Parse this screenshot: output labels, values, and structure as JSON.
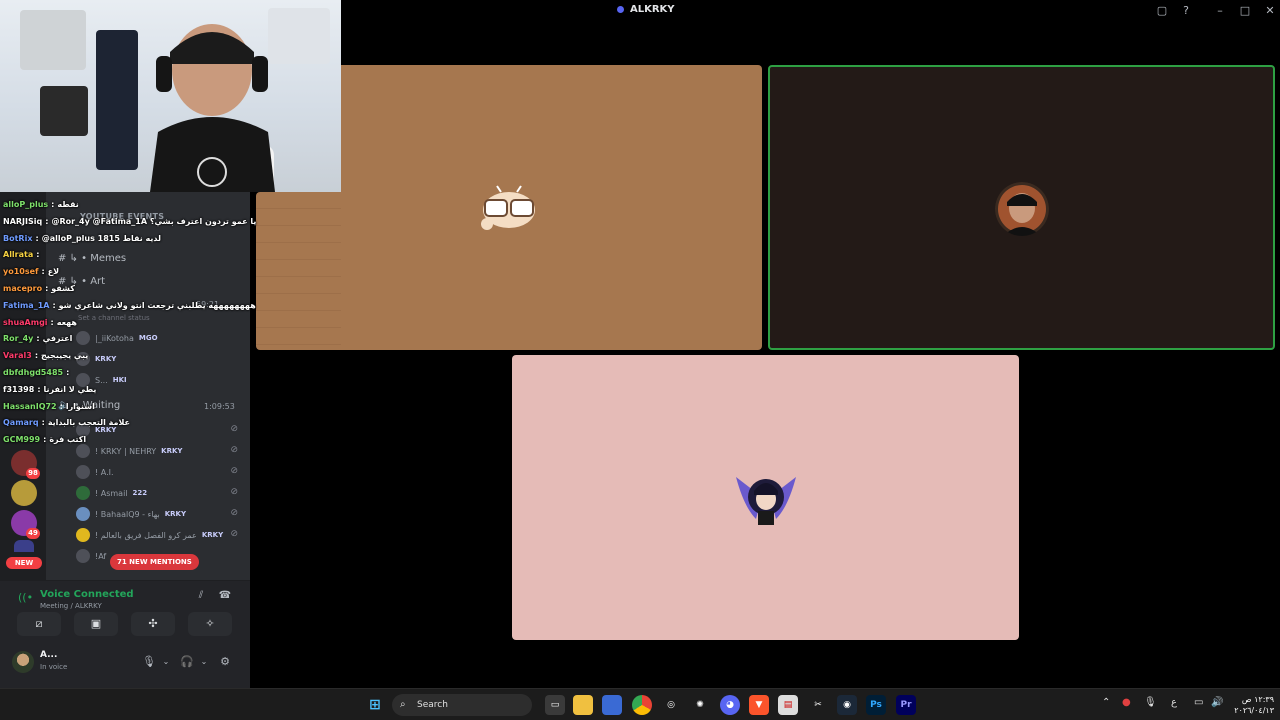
{
  "window": {
    "title": "ALKRKY"
  },
  "sidebar": {
    "server_badges": [
      "98",
      "49"
    ],
    "new_label": "NEW",
    "categories": [
      "YOUTUBE EVENTS"
    ],
    "channels": [
      "Memes",
      "Art"
    ],
    "channel_status": "Set a channel status",
    "events_time": "59:21",
    "waiting_label": "Waiting",
    "waiting_time": "1:09:53",
    "members": [
      {
        "name": "|_iiKotoha",
        "tag": "MGO"
      },
      {
        "name": "KRKY",
        "tag": ""
      },
      {
        "name": "S...",
        "tag": "HKI"
      },
      {
        "name": "KRKY",
        "tag": ""
      },
      {
        "name": "! KRKY | NEHRY",
        "tag": "KRKY"
      },
      {
        "name": "! A.I.",
        "tag": ""
      },
      {
        "name": "! Asmail",
        "tag": "222"
      },
      {
        "name": "! BahaalQ9 - بهاء",
        "tag": "KRKY"
      },
      {
        "name": "! عمر كرو الفصل فريق بالعالم",
        "tag": "KRKY"
      },
      {
        "name": "!Af",
        "tag": ""
      }
    ],
    "mentions_label": "71 NEW MENTIONS"
  },
  "chat": [
    {
      "user": "alloP_plus",
      "msg": "نقطه",
      "color": "#7ee06b"
    },
    {
      "user": "NARJISiq",
      "msg": "@Ror_4y @Fatima_1A يا عمو تردون اعترف بشي؟",
      "color": "#ffffff"
    },
    {
      "user": "BotRix",
      "msg": "@alloP_plus لديه نقاط 1815",
      "color": "#6f9bff"
    },
    {
      "user": "Allrata",
      "msg": "",
      "color": "#f5d142"
    },
    {
      "user": "yo10sef",
      "msg": "لاع",
      "color": "#ff9a3c"
    },
    {
      "user": "macepro",
      "msg": "كشفو",
      "color": "#ff9a3c"
    },
    {
      "user": "Fatima_1A",
      "msg": "ههههههههه يطلبني ترجعت انتو ولاني شاعري شو",
      "color": "#6f9bff"
    },
    {
      "user": "shuaAmgi",
      "msg": "ههعه",
      "color": "#ff3b6b"
    },
    {
      "user": "Ror_4y",
      "msg": "اعترفي",
      "color": "#7ee06b"
    },
    {
      "user": "Varal3",
      "msg": "يبي يجيبجيج",
      "color": "#ff3b6b"
    },
    {
      "user": "dbfdhgd5485",
      "msg": "",
      "color": "#7ee06b"
    },
    {
      "user": "f31398",
      "msg": "يطي لا انفرنا",
      "color": "#ffffff"
    },
    {
      "user": "HassanIQ72",
      "msg": "اسنوارا",
      "color": "#7ee06b"
    },
    {
      "user": "Qamarq",
      "msg": "علامة التعجب بالبداية",
      "color": "#6f9bff"
    },
    {
      "user": "GCM999",
      "msg": "اكتب فرة",
      "color": "#7ee06b"
    }
  ],
  "voice": {
    "status": "Voice Connected",
    "location": "Meeting / ALKRKY",
    "user_name": "A...",
    "user_status": "In voice"
  },
  "taskbar": {
    "search_placeholder": "Search",
    "photoshop": "Ps",
    "premiere": "Pr",
    "lang": "ع",
    "time": "١٢:٣٩ ص",
    "date": "٢٠٢٦/٠٤/١٣"
  },
  "colors": {
    "tile_1": "#a6774f",
    "tile_2": "#231a17",
    "tile_3": "#e5bbb7",
    "speaking": "#2ea043",
    "voice_green": "#23a55a",
    "mention_red": "#da373c"
  }
}
